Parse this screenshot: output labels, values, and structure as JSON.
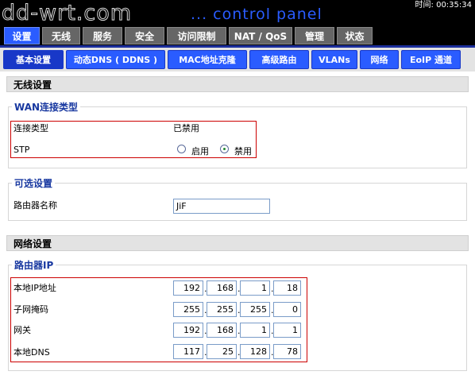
{
  "header": {
    "logo": "dd-wrt.com",
    "subtitle": "... control panel",
    "time": "时间: 00:35:34"
  },
  "main_tabs": [
    "设置",
    "无线",
    "服务",
    "安全",
    "访问限制",
    "NAT / QoS",
    "管理",
    "状态"
  ],
  "sub_tabs": [
    "基本设置",
    "动态DNS ( DDNS )",
    "MAC地址克隆",
    "高级路由",
    "VLANs",
    "网络",
    "EoIP 通道"
  ],
  "wireless_section": {
    "title": "无线设置"
  },
  "wan": {
    "legend": "WAN连接类型",
    "conn_type_label": "连接类型",
    "conn_type_value": "已禁用",
    "stp_label": "STP",
    "stp_enable": "启用",
    "stp_disable": "禁用",
    "stp_selected": "禁用"
  },
  "optional": {
    "legend": "可选设置",
    "router_name_label": "路由器名称",
    "router_name_value": "JiF"
  },
  "network_section": {
    "title": "网络设置"
  },
  "router_ip": {
    "legend": "路由器IP",
    "local_ip_label": "本地IP地址",
    "local_ip": [
      "192",
      "168",
      "1",
      "18"
    ],
    "subnet_label": "子网掩码",
    "subnet": [
      "255",
      "255",
      "255",
      "0"
    ],
    "gateway_label": "网关",
    "gateway": [
      "192",
      "168",
      "1",
      "1"
    ],
    "dns_label": "本地DNS",
    "dns": [
      "117",
      "25",
      "128",
      "78"
    ]
  }
}
